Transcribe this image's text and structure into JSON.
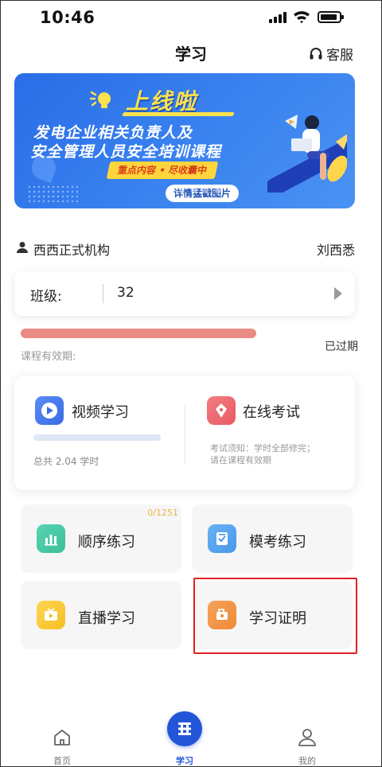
{
  "status_bar": {
    "time": "10:46"
  },
  "header": {
    "title": "学习",
    "service_label": "客服"
  },
  "banner": {
    "headline": "上线啦",
    "subtitle_line1": "发电企业相关负责人及",
    "subtitle_line2": "安全管理人员安全培训课程",
    "tag": "重点内容 • 尽收囊中",
    "detail_button": "详情猛戳图片",
    "page_count": 5,
    "active_page": 1
  },
  "org": {
    "name": "西西正式机构",
    "user": "刘西悉"
  },
  "class_card": {
    "label": "班级:",
    "value": "32"
  },
  "validity": {
    "label": "课程有效期:",
    "status": "已过期",
    "bar_color": "#e98a84"
  },
  "study": {
    "video": {
      "title": "视频学习",
      "total": "总共 2.04 学时",
      "progress": 0
    },
    "exam": {
      "title": "在线考试",
      "note_line1": "考试须知：学时全部修完；",
      "note_line2": "请在课程有效期"
    }
  },
  "tiles": {
    "sequential": {
      "label": "顺序练习",
      "count": "0/1251"
    },
    "mock": {
      "label": "模考练习"
    },
    "live": {
      "label": "直播学习"
    },
    "certificate": {
      "label": "学习证明",
      "highlighted": true,
      "highlight_color": "#e02222"
    }
  },
  "bottom_nav": {
    "home": {
      "label": "首页"
    },
    "study": {
      "label": "学习",
      "active": true
    },
    "mine": {
      "label": "我的"
    }
  },
  "colors": {
    "accent": "#2355d8",
    "highlight": "#e02222"
  }
}
